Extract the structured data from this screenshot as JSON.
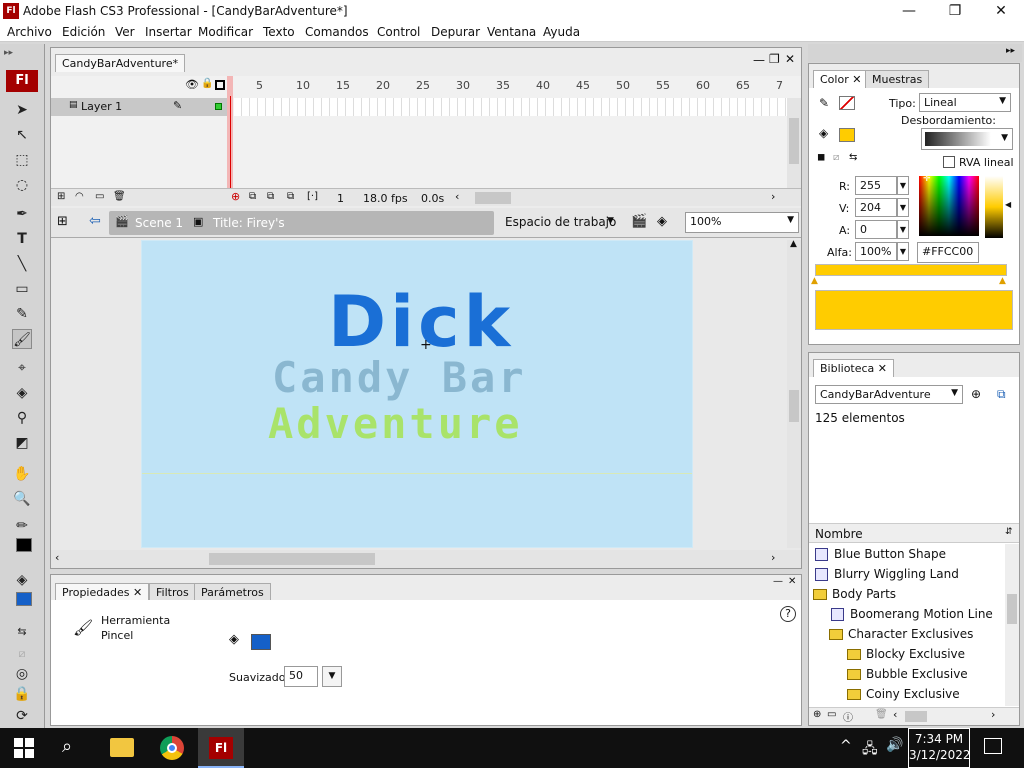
{
  "window": {
    "title": "Adobe Flash CS3 Professional - [CandyBarAdventure*]",
    "logo": "Fl"
  },
  "menu": [
    "Archivo",
    "Edición",
    "Ver",
    "Insertar",
    "Modificar",
    "Texto",
    "Comandos",
    "Control",
    "Depurar",
    "Ventana",
    "Ayuda"
  ],
  "document": {
    "tab": "CandyBarAdventure*",
    "layer": "Layer 1",
    "ruler": [
      "5",
      "10",
      "15",
      "20",
      "25",
      "30",
      "35",
      "40",
      "45",
      "50",
      "55",
      "60",
      "65",
      "7"
    ],
    "frame": "1",
    "fps": "18.0 fps",
    "time": "0.0s",
    "scene": "Scene 1",
    "symbol": "Title: Firey's",
    "workspace": "Espacio de trabajo",
    "zoom": "100%"
  },
  "stage": {
    "drawn": "Dick",
    "line1": "Candy Bar",
    "line2": "Adventure"
  },
  "properties": {
    "tabs": [
      "Propiedades",
      "Filtros",
      "Parámetros"
    ],
    "tool_label": "Herramienta",
    "tool_name": "Pincel",
    "smooth_label": "Suavizado",
    "smooth_value": "50",
    "fill_color": "#1560c8"
  },
  "color": {
    "tabs": [
      "Color",
      "Muestras"
    ],
    "type_label": "Tipo:",
    "type_value": "Lineal",
    "overflow_label": "Desbordamiento:",
    "rgb_linear": "RVA lineal",
    "r_label": "R:",
    "r": "255",
    "g_label": "V:",
    "g": "204",
    "b_label": "A:",
    "b": "0",
    "alpha_label": "Alfa:",
    "alpha": "100%",
    "hex": "#FFCC00"
  },
  "library": {
    "tab": "Biblioteca",
    "doc": "CandyBarAdventure",
    "count": "125 elementos",
    "column": "Nombre",
    "items": [
      {
        "name": "Blue Button Shape",
        "type": "symbol",
        "indent": 0
      },
      {
        "name": "Blurry Wiggling Land",
        "type": "symbol",
        "indent": 0
      },
      {
        "name": "Body Parts",
        "type": "folder-open",
        "indent": 0
      },
      {
        "name": "Boomerang Motion Line",
        "type": "symbol",
        "indent": 1
      },
      {
        "name": "Character Exclusives",
        "type": "folder-open",
        "indent": 1
      },
      {
        "name": "Blocky Exclusive",
        "type": "folder",
        "indent": 2
      },
      {
        "name": "Bubble Exclusive",
        "type": "folder",
        "indent": 2
      },
      {
        "name": "Coiny Exclusive",
        "type": "folder",
        "indent": 2
      }
    ]
  },
  "taskbar": {
    "time": "7:34 PM",
    "date": "3/12/2022"
  }
}
